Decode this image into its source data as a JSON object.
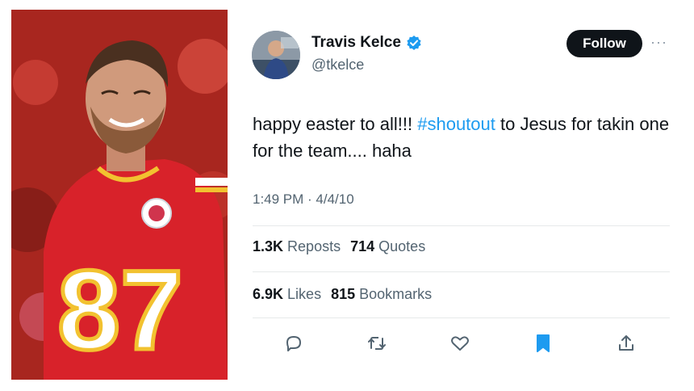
{
  "photo": {
    "jersey_number": "87"
  },
  "author": {
    "name": "Travis Kelce",
    "handle": "@tkelce",
    "verified": true
  },
  "follow_label": "Follow",
  "more_label": "···",
  "tweet": {
    "text_before": "happy easter to all!!! ",
    "hashtag": "#shoutout",
    "text_after": " to Jesus for takin one for the team.... haha",
    "timestamp": "1:49 PM · 4/4/10"
  },
  "stats": {
    "reposts_count": "1.3K",
    "reposts_label": "Reposts",
    "quotes_count": "714",
    "quotes_label": "Quotes",
    "likes_count": "6.9K",
    "likes_label": "Likes",
    "bookmarks_count": "815",
    "bookmarks_label": "Bookmarks"
  },
  "colors": {
    "accent": "#1d9bf0",
    "text": "#0f1419",
    "secondary_text": "#536471"
  },
  "icons": [
    "reply-icon",
    "repost-icon",
    "like-icon",
    "bookmark-icon",
    "share-icon"
  ]
}
